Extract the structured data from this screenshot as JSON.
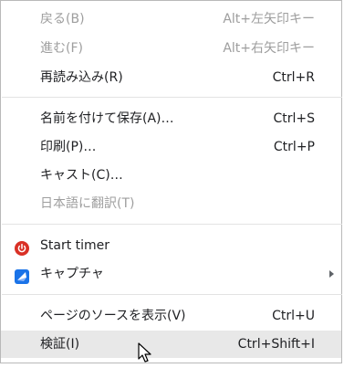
{
  "menu": {
    "items": [
      {
        "label": "戻る(B)",
        "shortcut": "Alt+左矢印キー",
        "enabled": false
      },
      {
        "label": "進む(F)",
        "shortcut": "Alt+右矢印キー",
        "enabled": false
      },
      {
        "label": "再読み込み(R)",
        "shortcut": "Ctrl+R",
        "enabled": true
      },
      {
        "label": "名前を付けて保存(A)…",
        "shortcut": "Ctrl+S",
        "enabled": true
      },
      {
        "label": "印刷(P)…",
        "shortcut": "Ctrl+P",
        "enabled": true
      },
      {
        "label": "キャスト(C)…",
        "shortcut": "",
        "enabled": true
      },
      {
        "label": "日本語に翻訳(T)",
        "shortcut": "",
        "enabled": false
      },
      {
        "label": "Start timer",
        "shortcut": "",
        "enabled": true,
        "icon": "power-icon"
      },
      {
        "label": "キャプチャ",
        "shortcut": "",
        "enabled": true,
        "icon": "capture-extension-icon",
        "submenu": true
      },
      {
        "label": "ページのソースを表示(V)",
        "shortcut": "Ctrl+U",
        "enabled": true
      },
      {
        "label": "検証(I)",
        "shortcut": "Ctrl+Shift+I",
        "enabled": true,
        "highlighted": true
      }
    ]
  },
  "colors": {
    "text": "#202124",
    "disabled_text": "#9e9e9e",
    "highlight": "#e8e8e8",
    "separator": "#e3e3e3",
    "timer_icon": "#d93025",
    "capture_icon": "#1a73e8"
  }
}
